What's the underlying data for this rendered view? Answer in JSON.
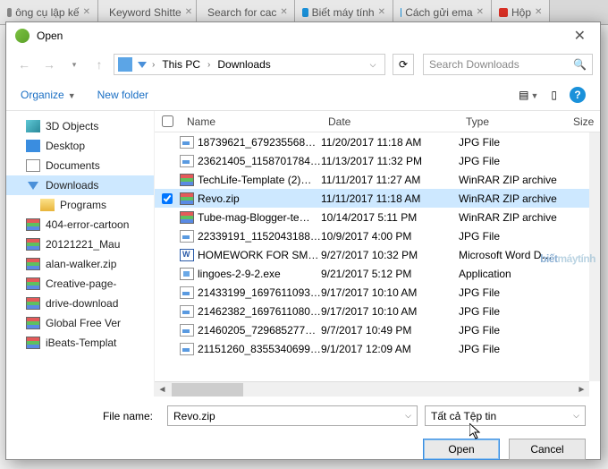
{
  "browser_tabs": [
    {
      "label": "ông cụ lập kế"
    },
    {
      "label": "Keyword Shitte"
    },
    {
      "label": "Search for cac",
      "color": "#f26522"
    },
    {
      "label": "Biết máy tính",
      "color": "#1a91da"
    },
    {
      "label": "Cách gửi ema",
      "color": "#1a91da"
    },
    {
      "label": "Hộp",
      "color": "#d93025"
    }
  ],
  "dialog": {
    "title": "Open",
    "close": "✕",
    "nav": {
      "back": "←",
      "fwd": "→",
      "up": "↑",
      "seg1": "This PC",
      "seg2": "Downloads",
      "refresh": "⟳"
    },
    "search_placeholder": "Search Downloads",
    "toolbar": {
      "organize": "Organize",
      "newfolder": "New folder",
      "help": "?"
    },
    "tree": [
      {
        "icon": "fold3d",
        "label": "3D Objects"
      },
      {
        "icon": "desk",
        "label": "Desktop"
      },
      {
        "icon": "doc",
        "label": "Documents"
      },
      {
        "icon": "down",
        "label": "Downloads",
        "sel": true
      },
      {
        "icon": "foldr",
        "label": "Programs",
        "sub": true
      },
      {
        "icon": "rar",
        "label": "404-error-cartoon"
      },
      {
        "icon": "rar",
        "label": "20121221_Mau"
      },
      {
        "icon": "rar",
        "label": "alan-walker.zip"
      },
      {
        "icon": "rar",
        "label": "Creative-page-"
      },
      {
        "icon": "rar",
        "label": "drive-download"
      },
      {
        "icon": "rar",
        "label": "Global Free Ver"
      },
      {
        "icon": "rar",
        "label": "iBeats-Templat"
      }
    ],
    "columns": {
      "name": "Name",
      "date": "Date",
      "type": "Type",
      "size": "Size"
    },
    "rows": [
      {
        "icon": "jpg",
        "name": "18739621_67923556894…",
        "date": "11/20/2017 11:18 AM",
        "type": "JPG File"
      },
      {
        "icon": "jpg",
        "name": "23621405_11587017842…",
        "date": "11/13/2017 11:32 PM",
        "type": "JPG File"
      },
      {
        "icon": "rar",
        "name": "TechLife-Template (2)…",
        "date": "11/11/2017 11:27 AM",
        "type": "WinRAR ZIP archive"
      },
      {
        "icon": "rar",
        "name": "Revo.zip",
        "date": "11/11/2017 11:18 AM",
        "type": "WinRAR ZIP archive",
        "sel": true,
        "chk": true
      },
      {
        "icon": "rar",
        "name": "Tube-mag-Blogger-te…",
        "date": "10/14/2017 5:11 PM",
        "type": "WinRAR ZIP archive"
      },
      {
        "icon": "jpg",
        "name": "22339191_11520431882…",
        "date": "10/9/2017 4:00 PM",
        "type": "JPG File"
      },
      {
        "icon": "docx",
        "name": "HOMEWORK FOR SMA…",
        "date": "9/27/2017 10:32 PM",
        "type": "Microsoft Word D…"
      },
      {
        "icon": "exe",
        "name": "lingoes-2-9-2.exe",
        "date": "9/21/2017 5:12 PM",
        "type": "Application"
      },
      {
        "icon": "jpg",
        "name": "21433199_16976110935…",
        "date": "9/17/2017 10:10 AM",
        "type": "JPG File"
      },
      {
        "icon": "jpg",
        "name": "21462382_16976110802…",
        "date": "9/17/2017 10:10 AM",
        "type": "JPG File"
      },
      {
        "icon": "jpg",
        "name": "21460205_72968527723…",
        "date": "9/7/2017 10:49 PM",
        "type": "JPG File"
      },
      {
        "icon": "jpg",
        "name": "21151260_83553406995…",
        "date": "9/1/2017 12:09 AM",
        "type": "JPG File"
      }
    ],
    "filename_label": "File name:",
    "filename_value": "Revo.zip",
    "filter_value": "Tất cả Tệp tin",
    "open": "Open",
    "cancel": "Cancel"
  },
  "watermark": {
    "a": "biết",
    "b": "máytính"
  }
}
